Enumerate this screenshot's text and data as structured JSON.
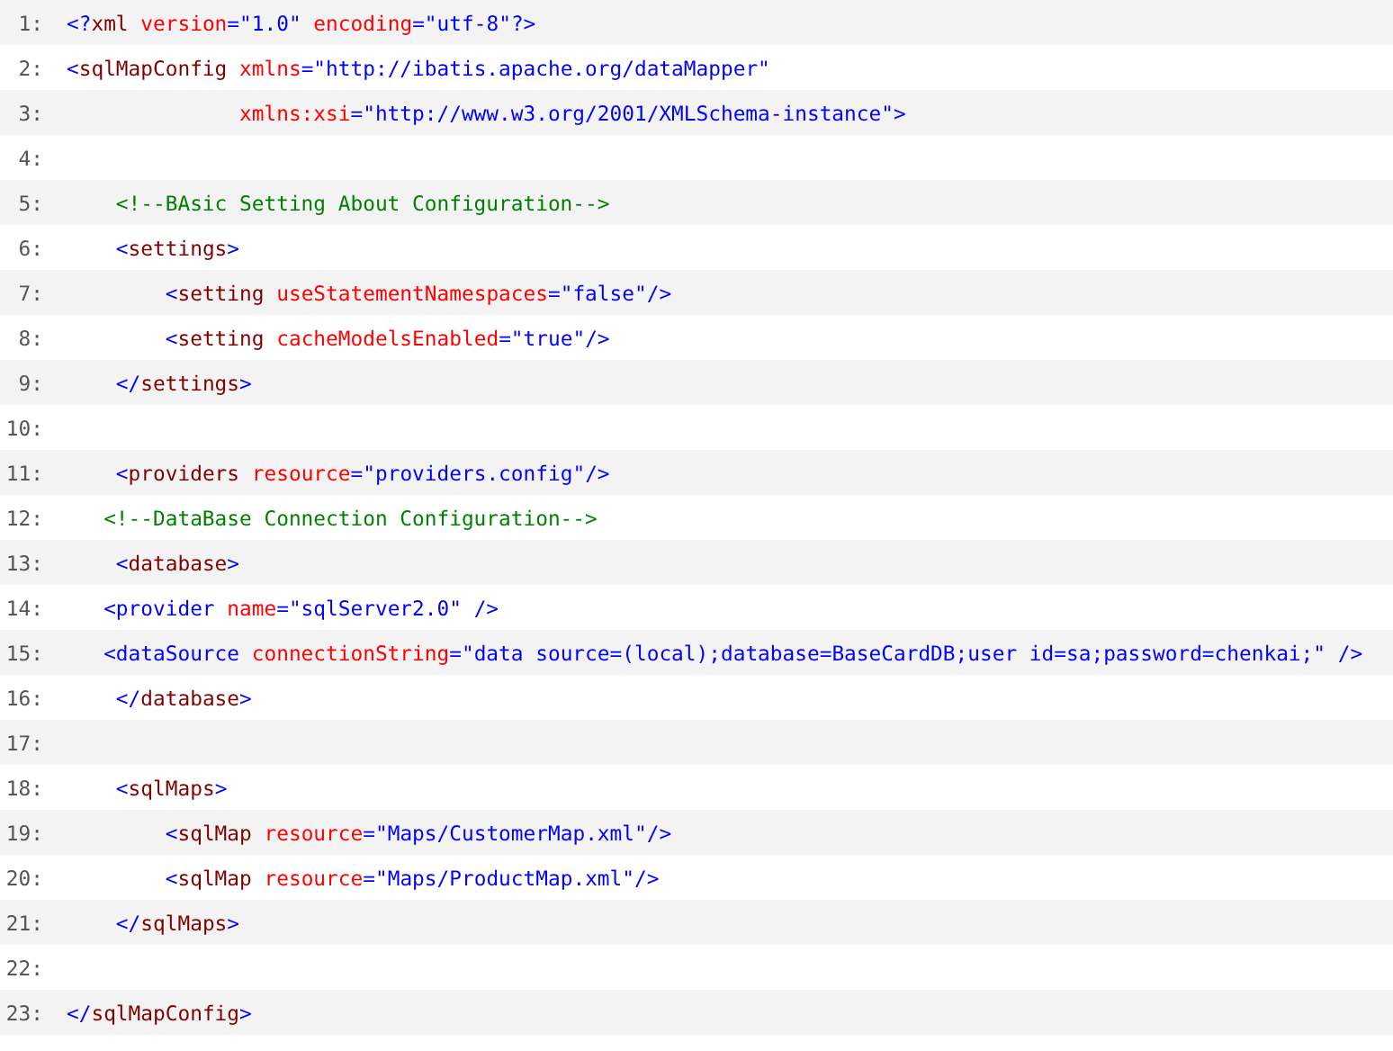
{
  "code_lines": [
    {
      "number": "1:",
      "segments": [
        {
          "kind": "bracket",
          "text": "<?"
        },
        {
          "kind": "tag",
          "text": "xml"
        },
        {
          "kind": "attr",
          "text": " version"
        },
        {
          "kind": "value",
          "text": "=\"1.0\""
        },
        {
          "kind": "attr",
          "text": " encoding"
        },
        {
          "kind": "value",
          "text": "=\"utf-8\""
        },
        {
          "kind": "bracket",
          "text": "?>"
        }
      ]
    },
    {
      "number": "2:",
      "segments": [
        {
          "kind": "bracket",
          "text": "<"
        },
        {
          "kind": "tag",
          "text": "sqlMapConfig"
        },
        {
          "kind": "attr",
          "text": " xmlns"
        },
        {
          "kind": "value",
          "text": "=\"http://ibatis.apache.org/dataMapper\""
        }
      ]
    },
    {
      "number": "3:",
      "segments": [
        {
          "kind": "attr",
          "text": "              xmlns:xsi"
        },
        {
          "kind": "value",
          "text": "=\"http://www.w3.org/2001/XMLSchema-instance\""
        },
        {
          "kind": "bracket",
          "text": ">"
        }
      ]
    },
    {
      "number": "4:"
    },
    {
      "number": "5:",
      "segments": [
        {
          "kind": "comment",
          "text": "    <!--BAsic Setting About Configuration-->"
        }
      ]
    },
    {
      "number": "6:",
      "segments": [
        {
          "kind": "bracket",
          "text": "    <"
        },
        {
          "kind": "tag",
          "text": "settings"
        },
        {
          "kind": "bracket",
          "text": ">"
        }
      ]
    },
    {
      "number": "7:",
      "segments": [
        {
          "kind": "bracket",
          "text": "        <"
        },
        {
          "kind": "tag",
          "text": "setting"
        },
        {
          "kind": "attr",
          "text": " useStatementNamespaces"
        },
        {
          "kind": "value",
          "text": "=\"false\""
        },
        {
          "kind": "bracket",
          "text": "/>"
        }
      ]
    },
    {
      "number": "8:",
      "segments": [
        {
          "kind": "bracket",
          "text": "        <"
        },
        {
          "kind": "tag",
          "text": "setting"
        },
        {
          "kind": "attr",
          "text": " cacheModelsEnabled"
        },
        {
          "kind": "value",
          "text": "=\"true\""
        },
        {
          "kind": "bracket",
          "text": "/>"
        }
      ]
    },
    {
      "number": "9:",
      "segments": [
        {
          "kind": "bracket",
          "text": "    </"
        },
        {
          "kind": "tag",
          "text": "settings"
        },
        {
          "kind": "bracket",
          "text": ">"
        }
      ]
    },
    {
      "number": "10:"
    },
    {
      "number": "11:",
      "segments": [
        {
          "kind": "bracket",
          "text": "    <"
        },
        {
          "kind": "tag",
          "text": "providers"
        },
        {
          "kind": "attr",
          "text": " resource"
        },
        {
          "kind": "value",
          "text": "=\"providers.config\""
        },
        {
          "kind": "bracket",
          "text": "/>"
        }
      ]
    },
    {
      "number": "12:",
      "segments": [
        {
          "kind": "comment",
          "text": "   <!--DataBase Connection Configuration-->"
        }
      ]
    },
    {
      "number": "13:",
      "segments": [
        {
          "kind": "bracket",
          "text": "    <"
        },
        {
          "kind": "tag",
          "text": "database"
        },
        {
          "kind": "bracket",
          "text": ">"
        }
      ]
    },
    {
      "number": "14:",
      "segments": [
        {
          "kind": "bracket",
          "text": "   <provider"
        },
        {
          "kind": "attr",
          "text": " name"
        },
        {
          "kind": "value",
          "text": "=\"sqlServer2.0\""
        },
        {
          "kind": "bracket",
          "text": " />"
        }
      ]
    },
    {
      "number": "15:",
      "segments": [
        {
          "kind": "bracket",
          "text": "   <dataSource"
        },
        {
          "kind": "attr",
          "text": " connectionString"
        },
        {
          "kind": "value",
          "text": "=\"data source=(local);database=BaseCardDB;user id=sa;password=chenkai;\""
        },
        {
          "kind": "bracket",
          "text": " />"
        }
      ]
    },
    {
      "number": "16:",
      "segments": [
        {
          "kind": "bracket",
          "text": "    </"
        },
        {
          "kind": "tag",
          "text": "database"
        },
        {
          "kind": "bracket",
          "text": ">"
        }
      ]
    },
    {
      "number": "17:"
    },
    {
      "number": "18:",
      "segments": [
        {
          "kind": "bracket",
          "text": "    <"
        },
        {
          "kind": "tag",
          "text": "sqlMaps"
        },
        {
          "kind": "bracket",
          "text": ">"
        }
      ]
    },
    {
      "number": "19:",
      "segments": [
        {
          "kind": "bracket",
          "text": "        <"
        },
        {
          "kind": "tag",
          "text": "sqlMap"
        },
        {
          "kind": "attr",
          "text": " resource"
        },
        {
          "kind": "value",
          "text": "=\"Maps/CustomerMap.xml\""
        },
        {
          "kind": "bracket",
          "text": "/>"
        }
      ]
    },
    {
      "number": "20:",
      "segments": [
        {
          "kind": "bracket",
          "text": "        <"
        },
        {
          "kind": "tag",
          "text": "sqlMap"
        },
        {
          "kind": "attr",
          "text": " resource"
        },
        {
          "kind": "value",
          "text": "=\"Maps/ProductMap.xml\""
        },
        {
          "kind": "bracket",
          "text": "/>"
        }
      ]
    },
    {
      "number": "21:",
      "segments": [
        {
          "kind": "bracket",
          "text": "    </"
        },
        {
          "kind": "tag",
          "text": "sqlMaps"
        },
        {
          "kind": "bracket",
          "text": ">"
        }
      ]
    },
    {
      "number": "22:"
    },
    {
      "number": "23:",
      "segments": [
        {
          "kind": "bracket",
          "text": "</"
        },
        {
          "kind": "tag",
          "text": "sqlMapConfig"
        },
        {
          "kind": "bracket",
          "text": ">"
        }
      ]
    }
  ]
}
